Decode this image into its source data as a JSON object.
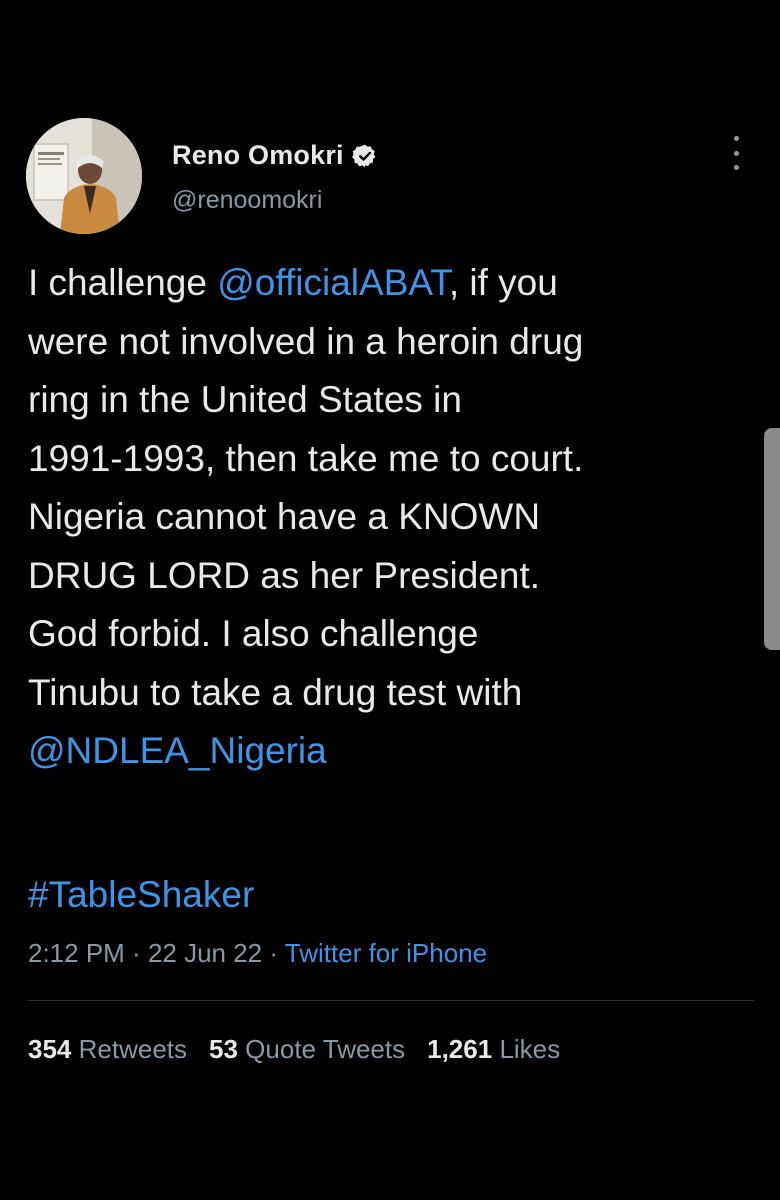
{
  "author": {
    "display_name": "Reno Omokri",
    "handle": "@renoomokri",
    "verified": true,
    "avatar_icon": "profile-photo"
  },
  "tweet": {
    "segments": [
      {
        "text": "I challenge ",
        "type": "text"
      },
      {
        "text": "@officialABAT",
        "type": "mention"
      },
      {
        "text": ", if you\nwere not involved in a heroin drug\nring in the United States in\n1991-1993, then take me to court.\nNigeria cannot have a KNOWN\nDRUG LORD as her President.\nGod forbid. I also challenge\nTinubu to take a drug test with\n",
        "type": "text"
      },
      {
        "text": "@NDLEA_Nigeria",
        "type": "mention"
      }
    ],
    "hashtag": "#TableShaker"
  },
  "meta": {
    "time": "2:12 PM",
    "separator": " · ",
    "date": "22 Jun 22",
    "source": "Twitter for iPhone"
  },
  "stats": {
    "retweets": {
      "count": "354",
      "label": "Retweets"
    },
    "quote_tweets": {
      "count": "53",
      "label": "Quote Tweets"
    },
    "likes": {
      "count": "1,261",
      "label": "Likes"
    }
  },
  "colors": {
    "background": "#000000",
    "text": "#e7e9ea",
    "secondary": "#8b98a5",
    "accent": "#3d95e8"
  }
}
